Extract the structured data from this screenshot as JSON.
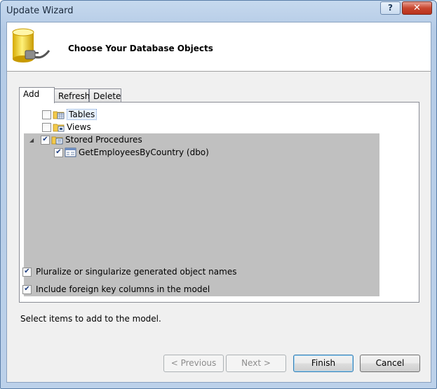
{
  "window": {
    "title": "Update Wizard",
    "help_label": "?",
    "close_label": "✕"
  },
  "header": {
    "title": "Choose Your Database Objects",
    "icon": "database-plug-icon"
  },
  "tabs": [
    {
      "label": "Add",
      "active": true
    },
    {
      "label": "Refresh",
      "active": false
    },
    {
      "label": "Delete",
      "active": false
    }
  ],
  "tree": {
    "tables": {
      "label": "Tables",
      "checked": false
    },
    "views": {
      "label": "Views",
      "checked": false
    },
    "stored_procedures": {
      "label": "Stored Procedures",
      "checked": true,
      "expanded": true,
      "children": [
        {
          "label": "GetEmployeesByCountry (dbo)",
          "checked": true
        }
      ]
    }
  },
  "options": {
    "pluralize": {
      "label": "Pluralize or singularize generated object names",
      "checked": true
    },
    "foreign_keys": {
      "label": "Include foreign key columns in the model",
      "checked": true
    }
  },
  "status": "Select items to add to the model.",
  "buttons": {
    "previous": "< Previous",
    "next": "Next >",
    "finish": "Finish",
    "cancel": "Cancel"
  }
}
